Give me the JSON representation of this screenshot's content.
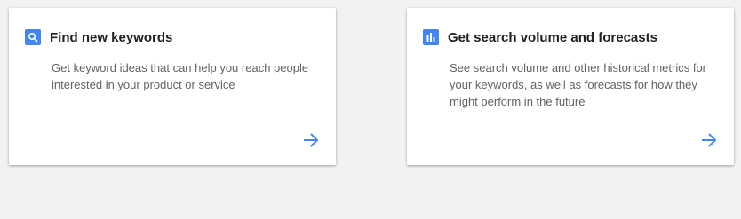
{
  "colors": {
    "accent": "#4285f4",
    "background": "#f2f2f2",
    "card": "#ffffff"
  },
  "cards": [
    {
      "icon": "search-icon",
      "title": "Find new keywords",
      "description": "Get keyword ideas that can help you reach people interested in your product or service"
    },
    {
      "icon": "bar-chart-icon",
      "title": "Get search volume and forecasts",
      "description": "See search volume and other historical metrics for your keywords, as well as forecasts for how they might perform in the future"
    }
  ]
}
